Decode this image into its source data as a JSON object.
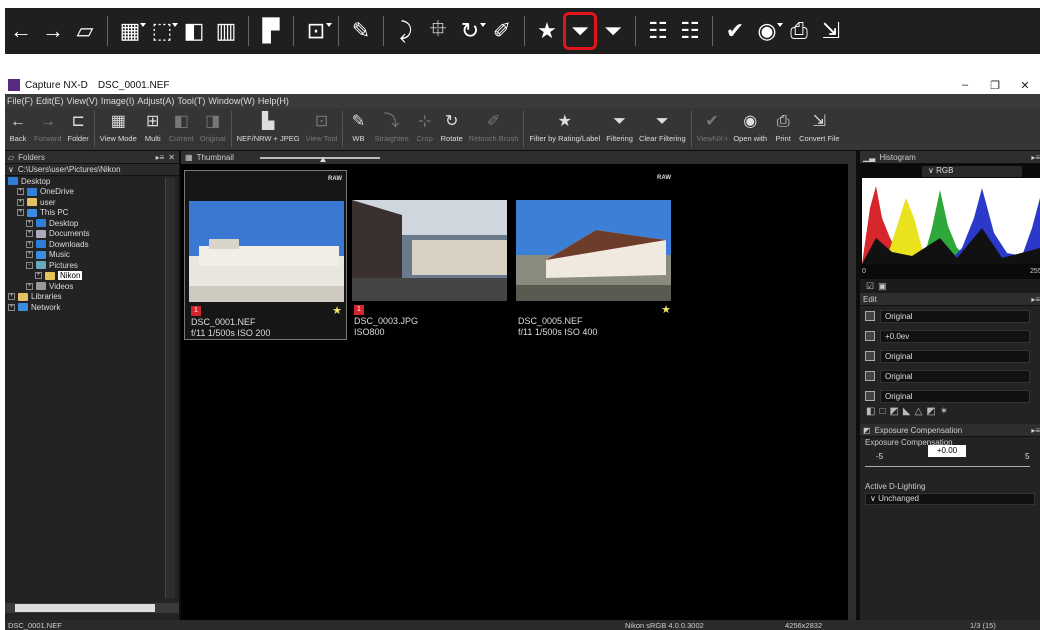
{
  "window": {
    "app": "Capture NX-D",
    "file": "DSC_0001.NEF"
  },
  "menu": [
    "File(F)",
    "Edit(E)",
    "View(V)",
    "Image(I)",
    "Adjust(A)",
    "Tool(T)",
    "Window(W)",
    "Help(H)"
  ],
  "top_toolbar_icons": [
    "back-arrow-icon",
    "forward-arrow-icon",
    "folder-icon",
    "grid-view-icon",
    "multi-view-icon",
    "compare-icon",
    "current-original-icon",
    "nef-jpeg-icon",
    "view-tool-icon",
    "white-balance-icon",
    "straighten-icon",
    "crop-icon",
    "rotate-icon",
    "retouch-brush-icon",
    "star-icon",
    "filter-icon",
    "clear-filter-icon",
    "export-list-icon",
    "export-clear-icon",
    "viewnx-icon",
    "open-with-app-icon",
    "print-icon",
    "convert-icon"
  ],
  "toolbar": [
    {
      "icon": "←",
      "label": "Back"
    },
    {
      "icon": "→",
      "label": "Forward",
      "dim": true
    },
    {
      "icon": "⊏",
      "label": "Folder"
    },
    {
      "icon": "▦",
      "label": "View Mode"
    },
    {
      "icon": "⊞",
      "label": "Multi"
    },
    {
      "icon": "◧",
      "label": "Current",
      "dim": true
    },
    {
      "icon": "◨",
      "label": "Original",
      "dim": true
    },
    {
      "icon": "▙",
      "label": "NEF/NRW + JPEG"
    },
    {
      "icon": "⊡",
      "label": "View Tool",
      "dim": true
    },
    {
      "icon": "✎",
      "label": "WB"
    },
    {
      "icon": "⤵",
      "label": "Straighten",
      "dim": true
    },
    {
      "icon": "⊹",
      "label": "Crop",
      "dim": true
    },
    {
      "icon": "↻",
      "label": "Rotate"
    },
    {
      "icon": "✐",
      "label": "Retouch Brush",
      "dim": true
    },
    {
      "icon": "★",
      "label": "Filter by Rating/Label"
    },
    {
      "icon": "⏷",
      "label": "Filtering"
    },
    {
      "icon": "⏷",
      "label": "Clear Filtering"
    },
    {
      "icon": "✔",
      "label": "ViewNX-i",
      "dim": true
    },
    {
      "icon": "◉",
      "label": "Open with"
    },
    {
      "icon": "⎙",
      "label": "Print"
    },
    {
      "icon": "⇲",
      "label": "Convert File"
    }
  ],
  "folders": {
    "title": "Folders",
    "path": "C:\\Users\\user\\Pictures\\Nikon",
    "tree": [
      {
        "label": "Desktop",
        "level": 0,
        "color": "#2d7fd8"
      },
      {
        "label": "OneDrive",
        "level": 1,
        "color": "#2d7fd8"
      },
      {
        "label": "user",
        "level": 1,
        "color": "#e4c066"
      },
      {
        "label": "This PC",
        "level": 1,
        "color": "#3a8de0"
      },
      {
        "label": "Desktop",
        "level": 2,
        "color": "#2d7fd8"
      },
      {
        "label": "Documents",
        "level": 2,
        "color": "#aab"
      },
      {
        "label": "Downloads",
        "level": 2,
        "color": "#2d7fd8"
      },
      {
        "label": "Music",
        "level": 2,
        "color": "#3a8de0"
      },
      {
        "label": "Pictures",
        "level": 2,
        "color": "#6ab"
      },
      {
        "label": "Nikon",
        "level": 3,
        "color": "#e8c35a",
        "selected": true
      },
      {
        "label": "Videos",
        "level": 2,
        "color": "#999"
      },
      {
        "label": "Libraries",
        "level": 0,
        "color": "#e4c066"
      },
      {
        "label": "Network",
        "level": 0,
        "color": "#3a8de0"
      }
    ]
  },
  "thumbnail": {
    "title": "Thumbnail",
    "items": [
      {
        "file": "DSC_0001.NEF",
        "exif": "f/11 1/500s ISO 200",
        "raw": "RAW",
        "tag": "1",
        "star": true,
        "selected": true
      },
      {
        "file": "DSC_0003.JPG",
        "exif": "ISO800",
        "raw": "",
        "tag": "1",
        "star": false,
        "selected": false
      },
      {
        "file": "DSC_0005.NEF",
        "exif": "f/11 1/500s ISO 400",
        "raw": "RAW",
        "tag": "",
        "star": true,
        "selected": false
      }
    ]
  },
  "histogram": {
    "title": "Histogram",
    "channel": "RGB",
    "min": "0",
    "max": "255"
  },
  "edit": {
    "title": "Edit",
    "rows": [
      "Original",
      "+0.0ev",
      "Original",
      "Original",
      "Original"
    ]
  },
  "exposure": {
    "title": "Exposure Compensation",
    "subtitle": "Exposure Compensation",
    "value": "+0.00",
    "min": "-5",
    "max": "5"
  },
  "adl": {
    "label": "Active D-Lighting",
    "value": "Unchanged"
  },
  "status": {
    "file": "DSC_0001.NEF",
    "profile": "Nikon sRGB 4.0.0.3002",
    "size": "4256x2832",
    "page": "1/3 (15)"
  }
}
